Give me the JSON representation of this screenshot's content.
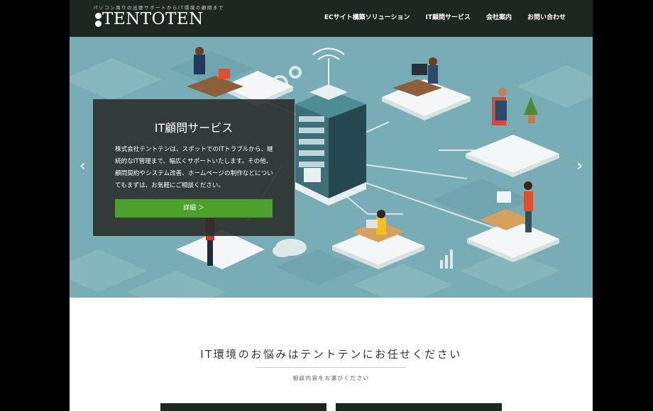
{
  "header": {
    "tagline": "パソコン周りの出張サポートからIT環境の顧問まで",
    "logo_text": "TENTOTEN",
    "nav": [
      {
        "label": "ECサイト構築ソリューション"
      },
      {
        "label": "IT顧問サービス"
      },
      {
        "label": "会社案内"
      },
      {
        "label": "お問い合わせ"
      }
    ]
  },
  "hero": {
    "prev_icon": "‹",
    "next_icon": "›",
    "card": {
      "title": "IT顧問サービス",
      "body": "株式会社テントテンは、スポットでのITトラブルから、継続的なIT管理まで、幅広くサポートいたします。その他、顧問契約やシステム改善、ホームページの制作などについてもまずは、お気軽にご相談ください。",
      "button_label": "詳細 ＞"
    }
  },
  "section": {
    "title": "IT環境のお悩みはテントテンにお任せください",
    "subtitle": "相談内容をお選びください"
  },
  "colors": {
    "header_bg": "#1d2722",
    "hero_bg": "#79adb6",
    "accent_green": "#4ca02c"
  }
}
